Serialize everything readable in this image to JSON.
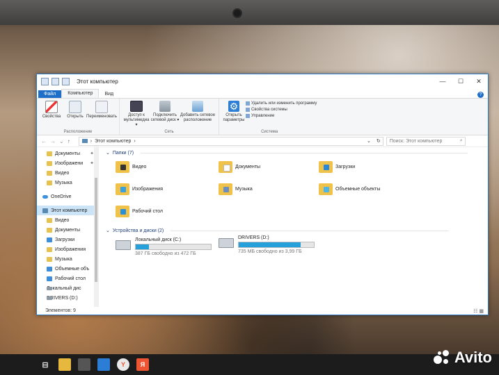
{
  "window": {
    "title": "Этот компьютер",
    "controls": {
      "minimize": "—",
      "maximize": "☐",
      "close": "✕"
    }
  },
  "ribbon": {
    "tabs": [
      {
        "label": "Файл"
      },
      {
        "label": "Компьютер"
      },
      {
        "label": "Вид"
      }
    ],
    "groups": [
      {
        "label": "Расположение",
        "buttons": [
          "Свойства",
          "Открыть",
          "Переименовать"
        ]
      },
      {
        "label": "Сеть",
        "buttons": [
          "Доступ к мультимедиа ▾",
          "Подключить сетевой диск ▾",
          "Добавить сетевое расположение"
        ]
      },
      {
        "label": "Система",
        "buttons": [
          "Открыть параметры"
        ],
        "links": [
          "Удалить или изменить программу",
          "Свойства системы",
          "Управление"
        ]
      }
    ]
  },
  "address": {
    "path": "Этот компьютер",
    "search_placeholder": "Поиск: Этот компьютер"
  },
  "nav_pane": {
    "items": [
      {
        "label": "Документы",
        "pinned": true
      },
      {
        "label": "Изображени",
        "pinned": true
      },
      {
        "label": "Видео"
      },
      {
        "label": "Музыка"
      },
      {
        "label": "OneDrive"
      },
      {
        "label": "Этот компьютер",
        "selected": true
      },
      {
        "label": "Видео"
      },
      {
        "label": "Документы"
      },
      {
        "label": "Загрузки"
      },
      {
        "label": "Изображения"
      },
      {
        "label": "Музыка"
      },
      {
        "label": "Объемные объ"
      },
      {
        "label": "Рабочий стол"
      },
      {
        "label": "Локальный дис"
      },
      {
        "label": "DRIVERS (D:)"
      }
    ]
  },
  "folders_section": {
    "header": "Папки (7)",
    "items": [
      {
        "label": "Видео",
        "icon": "video-folder-icon"
      },
      {
        "label": "Документы",
        "icon": "documents-folder-icon"
      },
      {
        "label": "Загрузки",
        "icon": "downloads-folder-icon"
      },
      {
        "label": "Изображения",
        "icon": "pictures-folder-icon"
      },
      {
        "label": "Музыка",
        "icon": "music-folder-icon"
      },
      {
        "label": "Объемные объекты",
        "icon": "3d-objects-folder-icon"
      },
      {
        "label": "Рабочий стол",
        "icon": "desktop-folder-icon"
      }
    ]
  },
  "drives_section": {
    "header": "Устройства и диски (2)",
    "items": [
      {
        "label": "Локальный диск (C:)",
        "free": "387 ГБ свободно из 472 ГБ",
        "used_fraction": 0.18
      },
      {
        "label": "DRIVERS (D:)",
        "free": "735 МБ свободно из 3,99 ГБ",
        "used_fraction": 0.82
      }
    ]
  },
  "status": {
    "count": "Элементов: 9"
  },
  "watermark": "Avito",
  "colors": {
    "accent": "#1f6fc9",
    "drive_bar": "#26a0da",
    "folder": "#f0c24a"
  }
}
